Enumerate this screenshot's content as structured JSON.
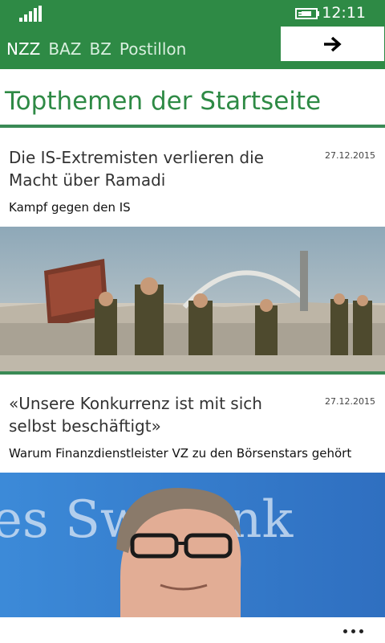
{
  "status_bar": {
    "time": "12:11",
    "signal_icon": "signal-strength-icon",
    "battery_icon": "battery-charging-icon"
  },
  "header": {
    "tabs": [
      {
        "label": "NZZ"
      },
      {
        "label": "BAZ"
      },
      {
        "label": "BZ"
      },
      {
        "label": "Postillon"
      }
    ],
    "go_button_icon": "arrow-right-icon"
  },
  "page_title": "Topthemen der Startseite",
  "articles": [
    {
      "headline": "Die IS-Extremisten verlieren die Macht über Ramadi",
      "date": "27.12.2015",
      "subtitle": "Kampf gegen den IS",
      "image": "soldiers-photo"
    },
    {
      "headline": "«Unsere Konkurrenz ist mit sich selbst beschäftigt»",
      "date": "27.12.2015",
      "subtitle": "Warum Finanzdienstleister VZ zu den Börsenstars gehört",
      "image": "banker-portrait-photo",
      "image_text": "es Sw Bank"
    }
  ],
  "app_bar": {
    "more_icon": "more-ellipsis-icon"
  },
  "colors": {
    "accent_green": "#2e8a45",
    "rule_green": "#3a8a55"
  }
}
